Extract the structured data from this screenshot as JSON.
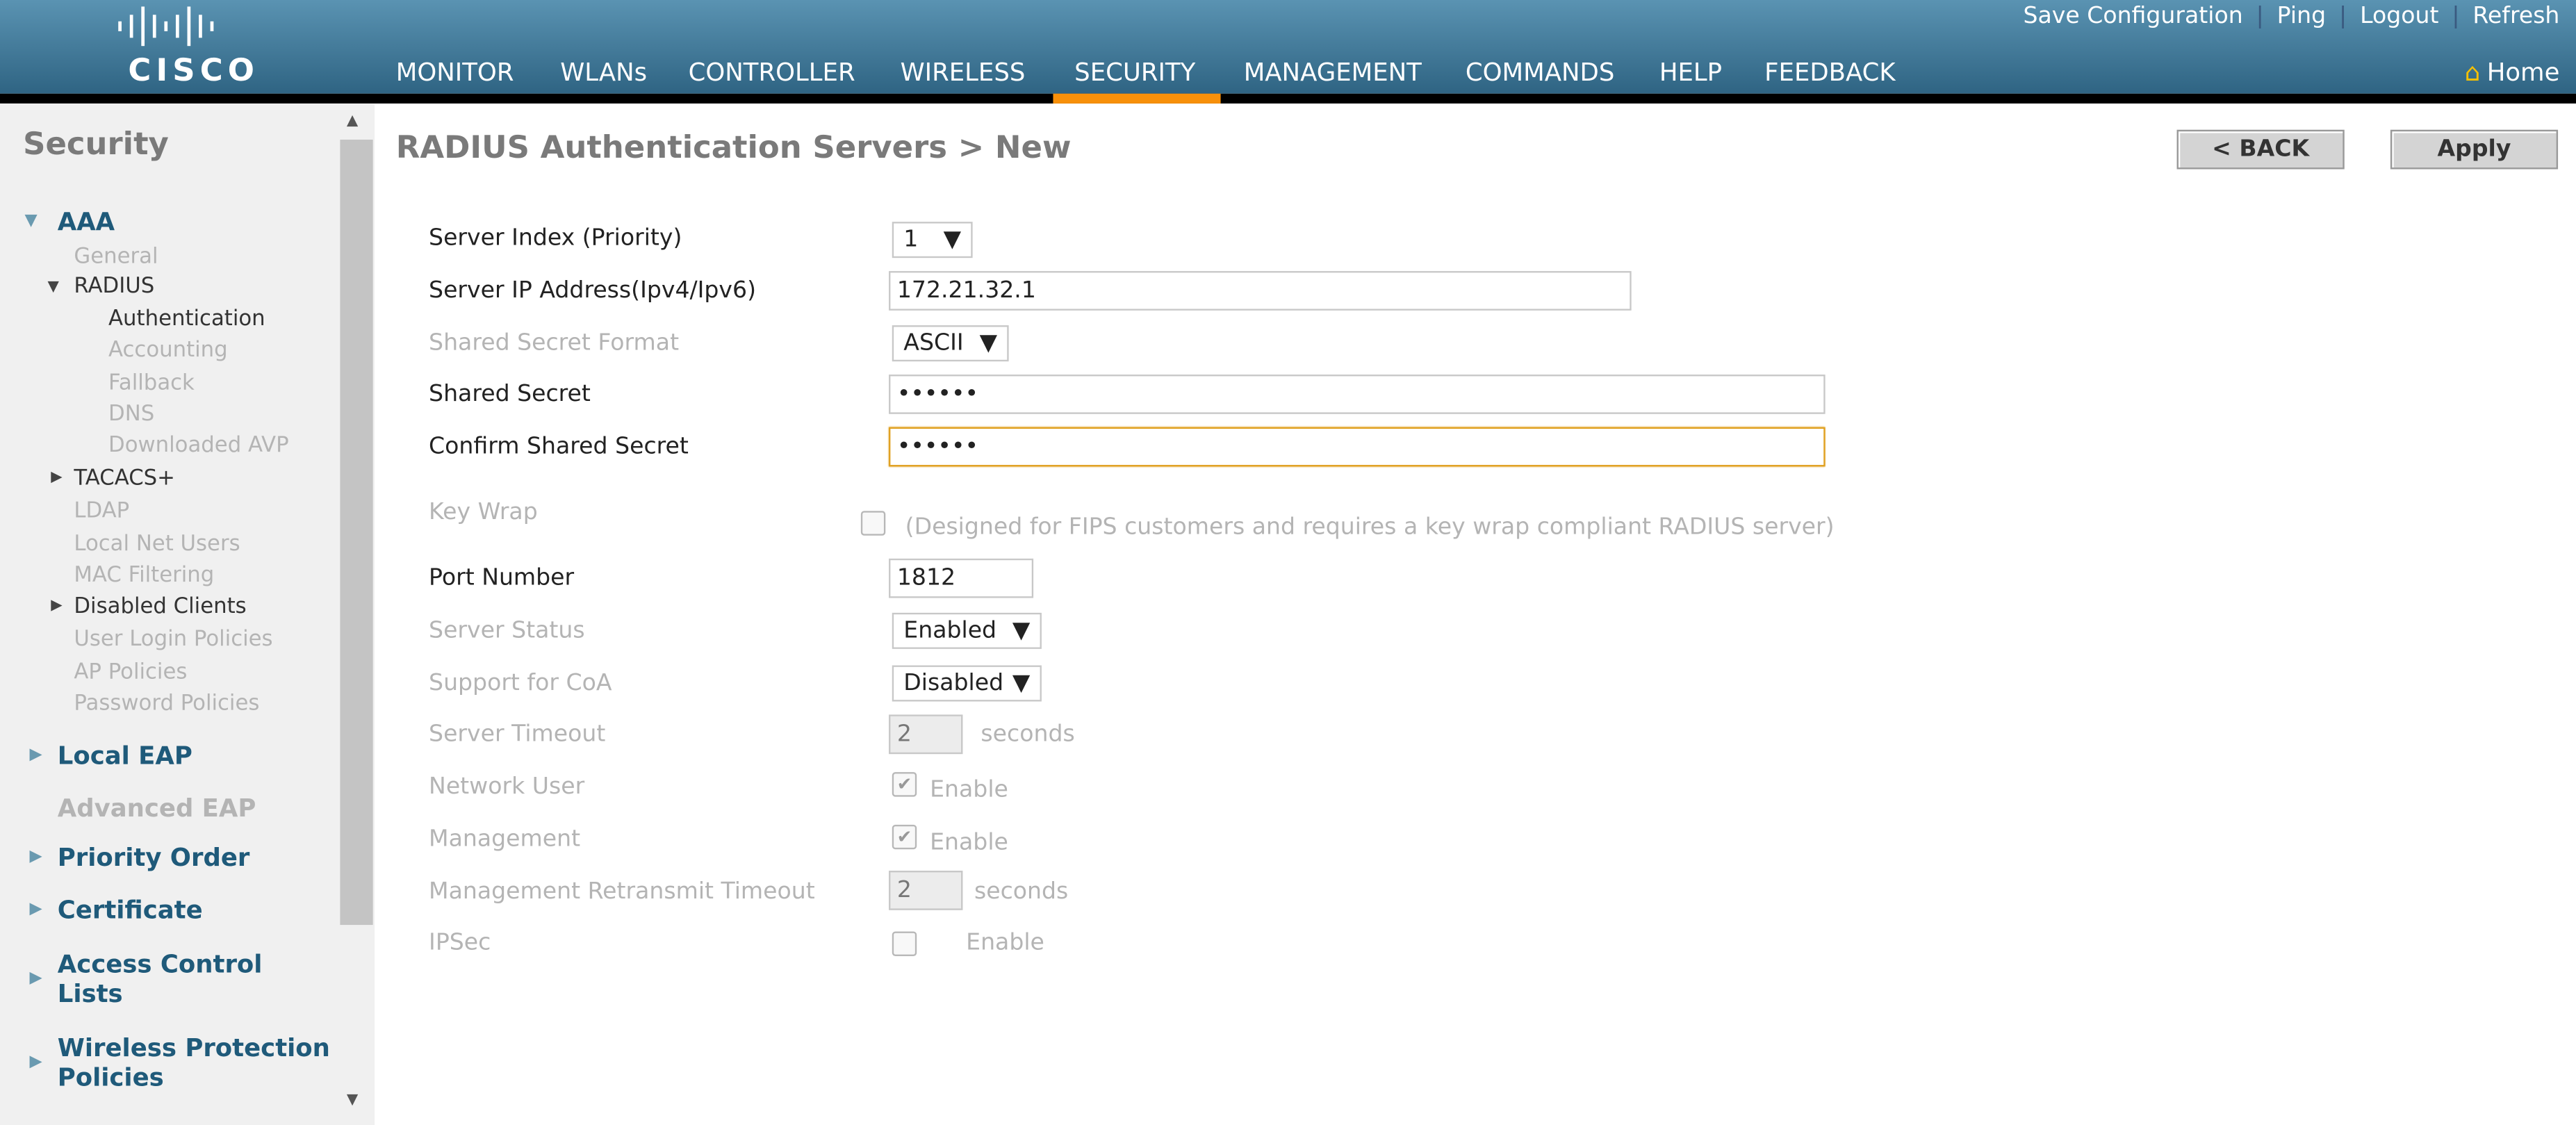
{
  "header": {
    "logo": "CISCO",
    "nav": [
      "MONITOR",
      "WLANs",
      "CONTROLLER",
      "WIRELESS",
      "SECURITY",
      "MANAGEMENT",
      "COMMANDS",
      "HELP",
      "FEEDBACK"
    ],
    "active_nav": "SECURITY",
    "accent": "#f7900a",
    "top_links": [
      "Save Configuration",
      "Ping",
      "Logout",
      "Refresh"
    ],
    "home": "Home"
  },
  "sidebar": {
    "title": "Security",
    "aaa": "AAA",
    "general": "General",
    "radius": "RADIUS",
    "authentication": "Authentication",
    "accounting": "Accounting",
    "fallback": "Fallback",
    "dns": "DNS",
    "downloaded_avp": "Downloaded AVP",
    "tacacs": "TACACS+",
    "ldap": "LDAP",
    "local_net_users": "Local Net Users",
    "mac_filtering": "MAC Filtering",
    "disabled_clients": "Disabled Clients",
    "user_login_policies": "User Login Policies",
    "ap_policies": "AP Policies",
    "password_policies": "Password Policies",
    "local_eap": "Local EAP",
    "advanced_eap": "Advanced EAP",
    "priority_order": "Priority Order",
    "certificate": "Certificate",
    "acl": "Access Control Lists",
    "wpp": "Wireless Protection Policies"
  },
  "page": {
    "title": "RADIUS Authentication Servers > New",
    "back": "< BACK",
    "apply": "Apply"
  },
  "form": {
    "server_index_label": "Server Index (Priority)",
    "server_index": "1",
    "server_ip_label": "Server IP Address(Ipv4/Ipv6)",
    "server_ip": "172.21.32.1",
    "secret_format_label": "Shared Secret Format",
    "secret_format": "ASCII",
    "secret_label": "Shared Secret",
    "secret": "••••••",
    "confirm_label": "Confirm Shared Secret",
    "confirm": "••••••",
    "keywrap_label": "Key Wrap",
    "keywrap_note": "(Designed for FIPS customers and requires a key wrap compliant RADIUS server)",
    "keywrap_checked": false,
    "port_label": "Port Number",
    "port": "1812",
    "status_label": "Server Status",
    "status": "Enabled",
    "coa_label": "Support for CoA",
    "coa": "Disabled",
    "timeout_label": "Server Timeout",
    "timeout": "2",
    "seconds": "seconds",
    "network_user_label": "Network User",
    "network_user_checked": true,
    "enable": "Enable",
    "management_label": "Management",
    "management_checked": true,
    "retransmit_label": "Management Retransmit Timeout",
    "retransmit": "2",
    "ipsec_label": "IPSec",
    "ipsec_checked": false
  }
}
